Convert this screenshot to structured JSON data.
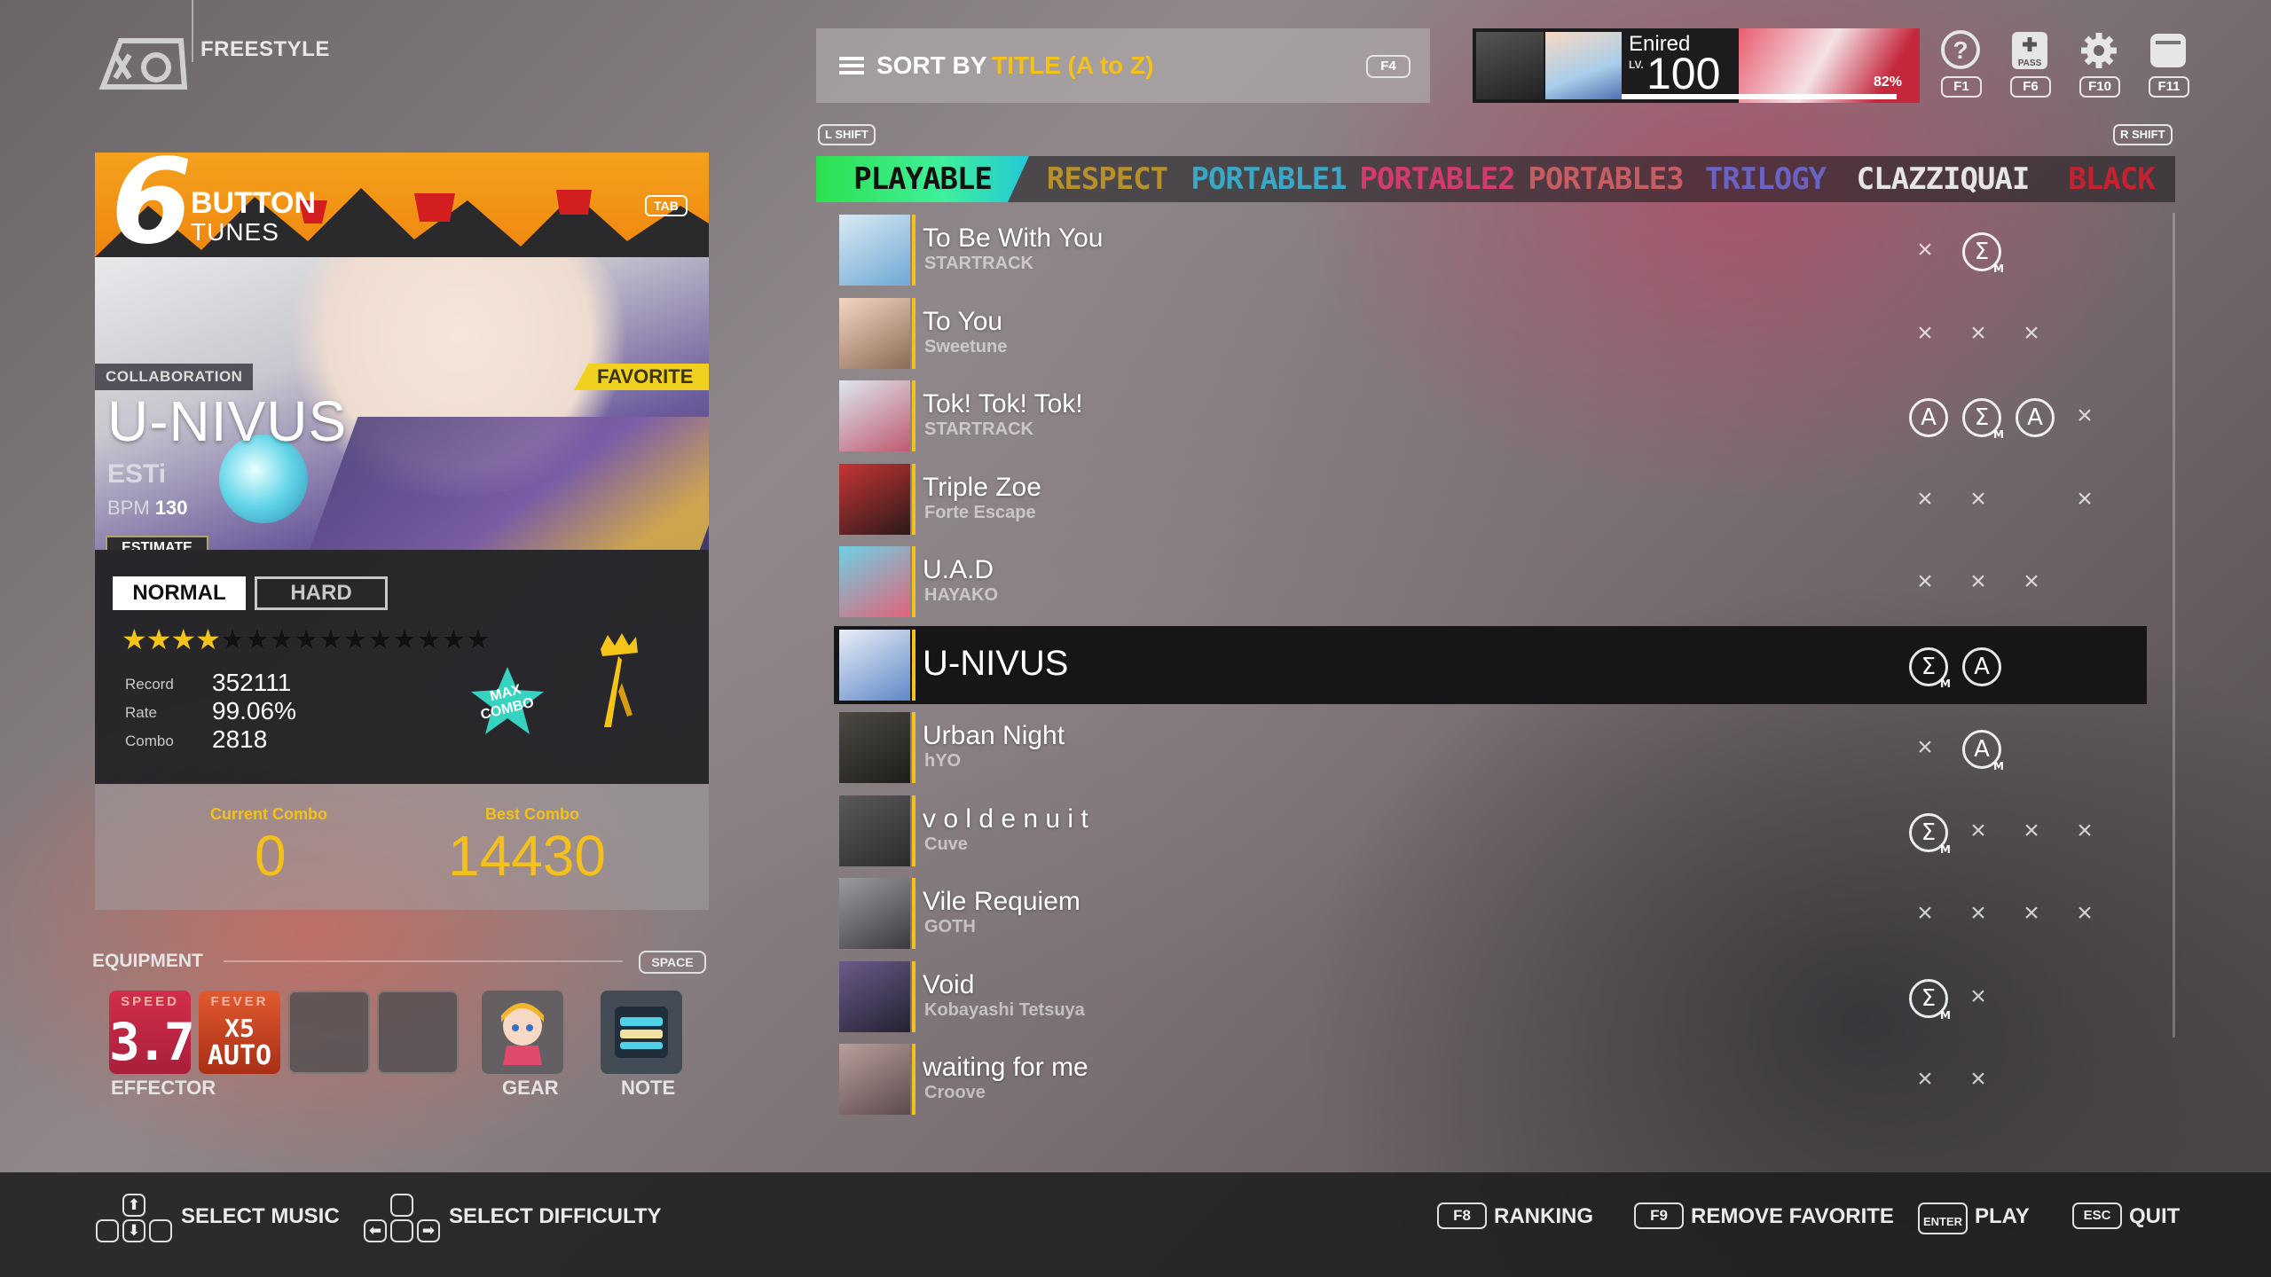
{
  "mode": {
    "title": "FREESTYLE"
  },
  "panel": {
    "button_count": "6",
    "button_word": "BUTTON",
    "tunes_word": "TUNES",
    "tab_key": "TAB",
    "collab_badge": "COLLABORATION",
    "favorite_label": "FAVORITE",
    "song_title": "U-NIVUS",
    "artist": "ESTi",
    "bpm_label": "BPM",
    "bpm_value": "130",
    "estimate_label": "ESTIMATE",
    "difficulty_normal": "NORMAL",
    "difficulty_hard": "HARD",
    "stars_filled": 4,
    "stars_total": 15,
    "record_label": "Record",
    "record_value": "352111",
    "rate_label": "Rate",
    "rate_value": "99.06%",
    "combo_label": "Combo",
    "combo_value": "2818",
    "maxcombo_badge": "MAX COMBO"
  },
  "combo": {
    "current_label": "Current Combo",
    "current_value": "0",
    "best_label": "Best Combo",
    "best_value": "14430"
  },
  "equipment": {
    "label": "EQUIPMENT",
    "space_key": "SPACE",
    "speed_tag": "SPEED",
    "speed_value": "3.7",
    "fever_tag": "FEVER",
    "fever_value_1": "X5",
    "fever_value_2": "AUTO",
    "effector_label": "EFFECTOR",
    "gear_label": "GEAR",
    "note_label": "NOTE"
  },
  "sort": {
    "label": "SORT BY",
    "value": "TITLE (A to Z)",
    "key": "F4"
  },
  "profile": {
    "name": "Enired",
    "lv_label": "LV.",
    "level": "100",
    "progress_percent": "82%"
  },
  "top_keys": {
    "help": "F1",
    "pass": "F6",
    "pass_label": "PASS",
    "settings": "F10",
    "exit": "F11",
    "lshift": "L SHIFT",
    "rshift": "R SHIFT"
  },
  "categories": [
    {
      "label": "PLAYABLE",
      "color": "#111111"
    },
    {
      "label": "RESPECT",
      "color": "#b8902b"
    },
    {
      "label": "PORTABLE1",
      "color": "#3aa7c7"
    },
    {
      "label": "PORTABLE2",
      "color": "#d43b6d"
    },
    {
      "label": "PORTABLE3",
      "color": "#c55d63"
    },
    {
      "label": "TRILOGY",
      "color": "#6a63c4"
    },
    {
      "label": "CLAZZIQUAI",
      "color": "#e6e6e6"
    },
    {
      "label": "BLACK",
      "color": "#c7202f"
    }
  ],
  "songs": [
    {
      "title": "To Be With You",
      "artist": "STARTRACK",
      "thumb": [
        "#d9eaf2",
        "#6fa8d6"
      ],
      "marks": [
        "x",
        "medalX"
      ]
    },
    {
      "title": "To You",
      "artist": "Sweetune",
      "thumb": [
        "#f3d6c2",
        "#8c6a55"
      ],
      "marks": [
        "x",
        "x",
        "x"
      ]
    },
    {
      "title": "Tok! Tok! Tok!",
      "artist": "STARTRACK",
      "thumb": [
        "#dde6f0",
        "#c05a70"
      ],
      "marks": [
        "medalA",
        "medalX",
        "medalA",
        "x"
      ]
    },
    {
      "title": "Triple Zoe",
      "artist": "Forte Escape",
      "thumb": [
        "#c73434",
        "#2a1a1a"
      ],
      "marks": [
        "x",
        "x",
        "",
        "x"
      ]
    },
    {
      "title": "U.A.D",
      "artist": "HAYAKO",
      "thumb": [
        "#6fd0e5",
        "#e06478"
      ],
      "marks": [
        "x",
        "x",
        "x"
      ]
    },
    {
      "title": "U-NIVUS",
      "artist": "",
      "thumb": [
        "#e9eef5",
        "#5e88c9"
      ],
      "marks": [
        "medalXM",
        "medalA"
      ],
      "selected": true
    },
    {
      "title": "Urban Night",
      "artist": "hYO",
      "thumb": [
        "#4d4a44",
        "#1e1d1a"
      ],
      "marks": [
        "x",
        "medalAM"
      ]
    },
    {
      "title": "v o l d e n u i t",
      "artist": "Cuve",
      "thumb": [
        "#5a5a5c",
        "#2c2c2e"
      ],
      "marks": [
        "medalXM",
        "x",
        "x",
        "x"
      ]
    },
    {
      "title": "Vile Requiem",
      "artist": "GOTH",
      "thumb": [
        "#9a9aa0",
        "#3a3a3e"
      ],
      "marks": [
        "x",
        "x",
        "x",
        "x"
      ]
    },
    {
      "title": "Void",
      "artist": "Kobayashi Tetsuya",
      "thumb": [
        "#6c5a8a",
        "#222230"
      ],
      "marks": [
        "medalXM",
        "x"
      ]
    },
    {
      "title": "waiting for me",
      "artist": "Croove",
      "thumb": [
        "#b99f9a",
        "#5b4a4e"
      ],
      "marks": [
        "x",
        "x"
      ]
    }
  ],
  "bottom": {
    "select_music": "SELECT MUSIC",
    "select_difficulty": "SELECT DIFFICULTY",
    "f8_key": "F8",
    "ranking": "RANKING",
    "f9_key": "F9",
    "remove_favorite": "REMOVE FAVORITE",
    "enter_key": "ENTER",
    "play": "PLAY",
    "esc_key": "ESC",
    "quit": "QUIT"
  }
}
